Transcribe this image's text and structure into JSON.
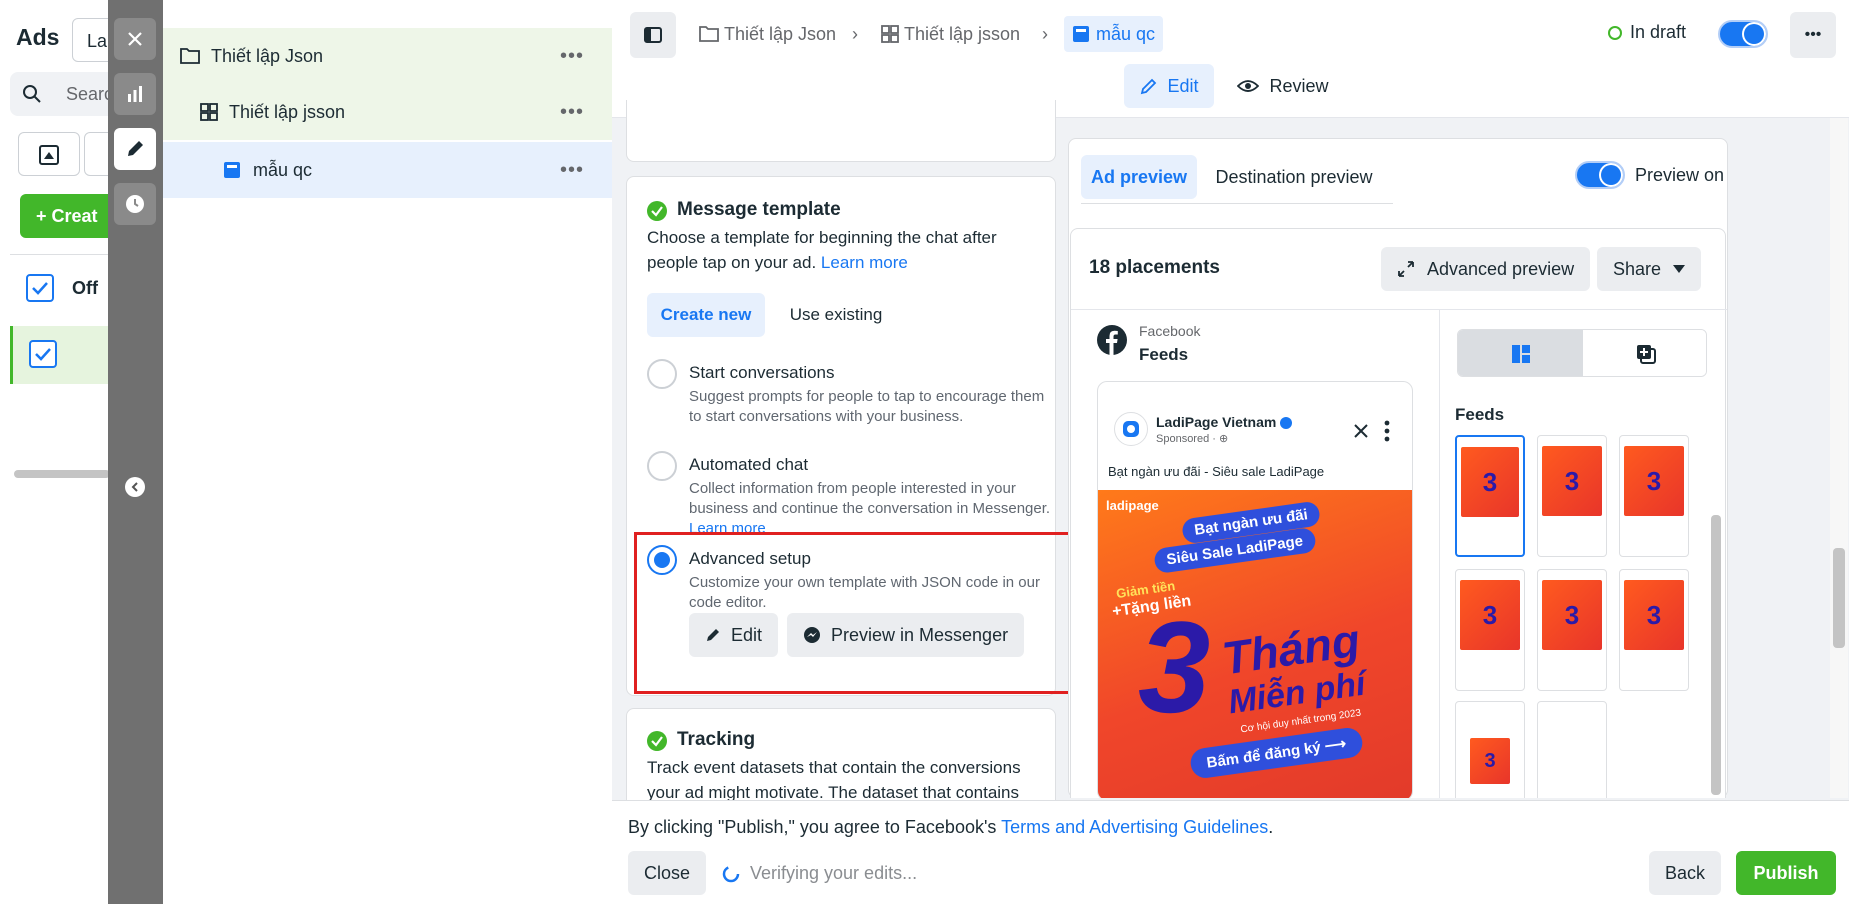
{
  "left": {
    "title": "Ads",
    "input_value": "La",
    "search_placeholder": "Searc",
    "create_label": "Creat",
    "col_header": "Off"
  },
  "tree": {
    "items": [
      {
        "label": "Thiết lập Json",
        "more": "•••"
      },
      {
        "label": "Thiết lập jsson",
        "more": "•••"
      },
      {
        "label": "mẫu qc",
        "more": "•••"
      }
    ]
  },
  "topbar": {
    "breadcrumbs": [
      "Thiết lập Json",
      "Thiết lập jsson",
      "mẫu qc"
    ],
    "status": "In draft",
    "more": "•••",
    "edit_label": "Edit",
    "review_label": "Review"
  },
  "message_template": {
    "title": "Message template",
    "desc": "Choose a template for beginning the chat after people tap on your ad.",
    "learn_more": "Learn more",
    "tabs": [
      "Create new",
      "Use existing"
    ],
    "options": [
      {
        "title": "Start conversations",
        "desc": "Suggest prompts for people to tap to encourage them to start conversations with your business."
      },
      {
        "title": "Automated chat",
        "desc": "Collect information from people interested in your business and continue the conversation in Messenger.",
        "link": "Learn more"
      },
      {
        "title": "Advanced setup",
        "desc": "Customize your own template with JSON code in our code editor."
      }
    ],
    "edit_button": "Edit",
    "preview_button": "Preview in Messenger"
  },
  "tracking": {
    "title": "Tracking",
    "desc": "Track event datasets that contain the conversions your ad might motivate. The dataset that contains the conversion"
  },
  "preview": {
    "tabs": [
      "Ad preview",
      "Destination preview"
    ],
    "preview_on": "Preview on",
    "placements": "18 placements",
    "advanced_preview": "Advanced preview",
    "share": "Share",
    "platform": "Facebook",
    "placement": "Feeds",
    "feeds_label": "Feeds",
    "page_name": "LadiPage Vietnam",
    "sponsored": "Sponsored · ⊕",
    "ad_text": "Bạt ngàn ưu đãi - Siêu sale LadiPage",
    "creative": {
      "brand": "ladipage",
      "headline1": "Bạt ngàn ưu đãi",
      "headline2": "Siêu Sale LadiPage",
      "promo1": "Giảm tiền",
      "promo2": "+Tặng liền",
      "big_number": "3",
      "months": "Tháng",
      "free": "Miễn phí",
      "tagline": "Cơ hội duy nhất trong 2023",
      "cta": "Bấm để đăng ký ⟶"
    }
  },
  "footer": {
    "agree_text": "By clicking \"Publish,\" you agree to Facebook's",
    "terms": "Terms and Advertising Guidelines",
    "period": ".",
    "close": "Close",
    "verifying": "Verifying your edits...",
    "back": "Back",
    "publish": "Publish"
  },
  "colors": {
    "accent": "#1877f2",
    "publish": "#42b72a",
    "highlight": "#e02020"
  }
}
